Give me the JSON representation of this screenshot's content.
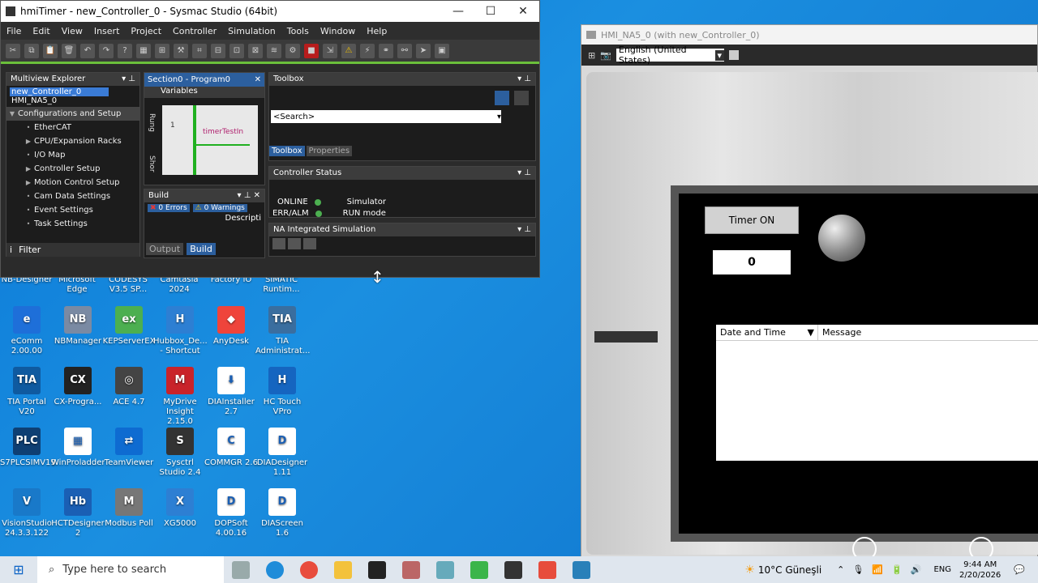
{
  "sysmac": {
    "title": "hmiTimer - new_Controller_0 - Sysmac Studio (64bit)",
    "menu": [
      "File",
      "Edit",
      "View",
      "Insert",
      "Project",
      "Controller",
      "Simulation",
      "Tools",
      "Window",
      "Help"
    ],
    "multiview": {
      "title": "Multiview Explorer",
      "selected_device": "new_Controller_0",
      "device2": "HMI_NA5_0",
      "group": "Configurations and Setup",
      "items": [
        {
          "label": "EtherCAT",
          "expand": false
        },
        {
          "label": "CPU/Expansion Racks",
          "expand": true
        },
        {
          "label": "I/O Map",
          "expand": false
        },
        {
          "label": "Controller Setup",
          "expand": true
        },
        {
          "label": "Motion Control Setup",
          "expand": true
        },
        {
          "label": "Cam Data Settings",
          "expand": false
        },
        {
          "label": "Event Settings",
          "expand": false
        },
        {
          "label": "Task Settings",
          "expand": false
        }
      ],
      "filter": "Filter"
    },
    "program_tab": "Section0 - Program0",
    "variables": "Variables",
    "run_label": "Rung",
    "short_label": "Shor",
    "rung_number": "1",
    "timer_var": "timerTestIn",
    "build": {
      "title": "Build",
      "errors": "0 Errors",
      "warnings": "0 Warnings",
      "desc": "Descripti",
      "tabs": [
        "Output",
        "Build"
      ]
    },
    "toolbox": {
      "title": "Toolbox",
      "search_placeholder": "<Search>",
      "tabs": [
        "Toolbox",
        "Properties"
      ]
    },
    "controller_status": {
      "title": "Controller Status",
      "online": "ONLINE",
      "simulator": "Simulator",
      "err": "ERR/ALM",
      "run_mode": "RUN mode"
    },
    "na_sim": "NA Integrated Simulation"
  },
  "hmi": {
    "title": "HMI_NA5_0 (with new_Controller_0)",
    "language": "English (United States)",
    "timer_button": "Timer ON",
    "value": "0",
    "alarm_headers": [
      "Date and Time",
      "Message"
    ]
  },
  "desktop_top_row": [
    "NB-Designer",
    "Microsoft Edge",
    "CODESYS V3.5 SP...",
    "Camtasia 2024",
    "Factory IO",
    "SIMATIC Runtim..."
  ],
  "desktop_icons": [
    {
      "label": "eComm 2.00.00",
      "color": "#1e6fd9",
      "glyph": "e"
    },
    {
      "label": "NBManager",
      "color": "#7a8aa3",
      "glyph": "NB"
    },
    {
      "label": "KEPServerEX",
      "color": "#4caf50",
      "glyph": "ex"
    },
    {
      "label": "Hubbox_De... - Shortcut",
      "color": "#2d7fd3",
      "glyph": "H"
    },
    {
      "label": "AnyDesk",
      "color": "#ef443b",
      "glyph": "◆"
    },
    {
      "label": "TIA Administrat...",
      "color": "#3a6e9f",
      "glyph": "TIA"
    },
    {
      "label": "TIA Portal V20",
      "color": "#0f5aa0",
      "glyph": "TIA"
    },
    {
      "label": "CX-Progra...",
      "color": "#222",
      "glyph": "CX"
    },
    {
      "label": "ACE 4.7",
      "color": "#444",
      "glyph": "◎"
    },
    {
      "label": "MyDrive Insight 2.15.0",
      "color": "#c9232a",
      "glyph": "M"
    },
    {
      "label": "DIAInstaller 2.7",
      "color": "#ffffff",
      "glyph": "⬇"
    },
    {
      "label": "HC Touch VPro",
      "color": "#1565c0",
      "glyph": "H"
    },
    {
      "label": "S7PLCSIMV19",
      "color": "#0e3f73",
      "glyph": "PLC"
    },
    {
      "label": "WinProladder",
      "color": "#ffffff",
      "glyph": "▦"
    },
    {
      "label": "TeamViewer",
      "color": "#0e6bd1",
      "glyph": "⇄"
    },
    {
      "label": "Sysctrl Studio 2.4",
      "color": "#333",
      "glyph": "S"
    },
    {
      "label": "COMMGR 2.6",
      "color": "#ffffff",
      "glyph": "C"
    },
    {
      "label": "DIADesigner 1.11",
      "color": "#ffffff",
      "glyph": "D"
    },
    {
      "label": "VisionStudio 24.3.3.122",
      "color": "#1979c9",
      "glyph": "V"
    },
    {
      "label": "HCTDesigner 2",
      "color": "#1a5fb4",
      "glyph": "Hb"
    },
    {
      "label": "Modbus Poll",
      "color": "#777",
      "glyph": "M"
    },
    {
      "label": "XG5000",
      "color": "#2d7fd3",
      "glyph": "X"
    },
    {
      "label": "DOPSoft 4.00.16",
      "color": "#ffffff",
      "glyph": "D"
    },
    {
      "label": "DIAScreen 1.6",
      "color": "#ffffff",
      "glyph": "D"
    }
  ],
  "taskbar": {
    "search_placeholder": "Type here to search",
    "weather": "10°C  Güneşli",
    "lang": "ENG",
    "time": "9:44 AM",
    "date": "2/20/2026"
  }
}
